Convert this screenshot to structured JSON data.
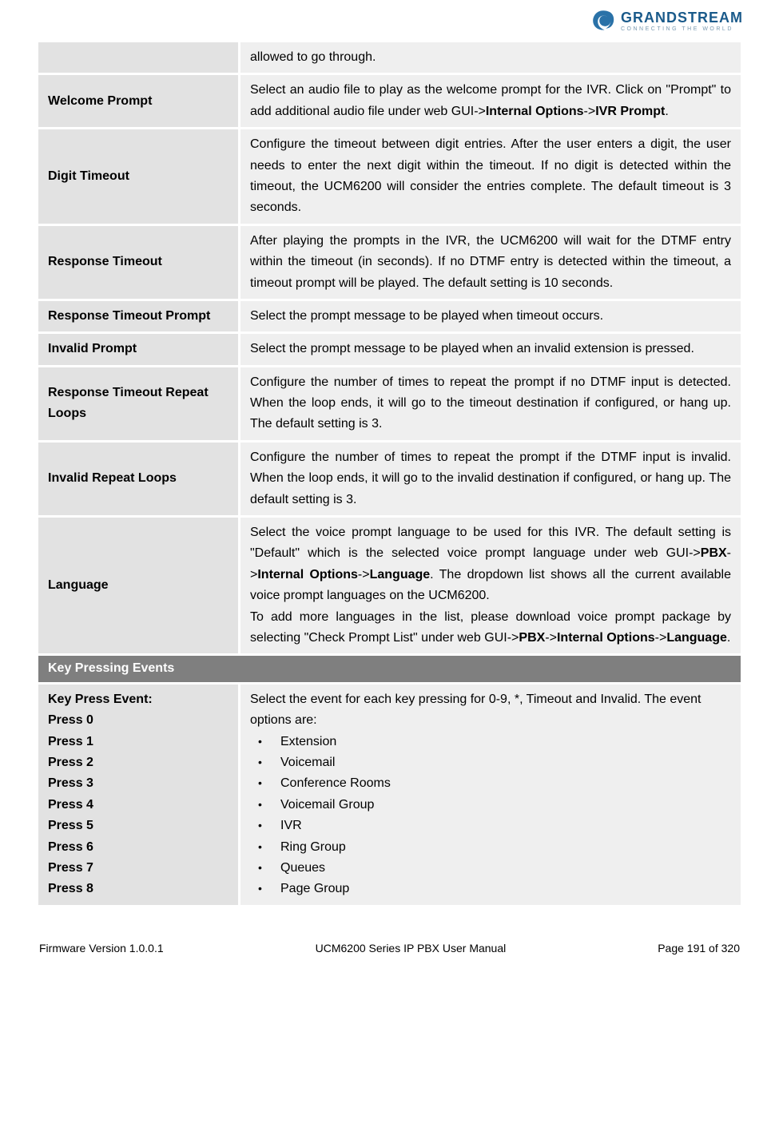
{
  "header": {
    "brand": "GRANDSTREAM",
    "tagline": "CONNECTING THE WORLD"
  },
  "rows": {
    "row0": {
      "desc": "allowed to go through."
    },
    "row1": {
      "label": "Welcome Prompt",
      "desc_pre": "Select an audio file to play as the welcome prompt for the IVR. Click on \"Prompt\" to add additional audio file under web GUI->",
      "b1": "Internal Options",
      "sep": "->",
      "b2": "IVR Prompt",
      "desc_post": "."
    },
    "row2": {
      "label": "Digit Timeout",
      "desc": "Configure the timeout between digit entries. After the user enters a digit, the user needs to enter the next digit within the timeout. If no digit is detected within the timeout, the UCM6200 will consider the entries complete. The default timeout is 3 seconds."
    },
    "row3": {
      "label": "Response Timeout",
      "desc": "After playing the prompts in the IVR, the UCM6200 will wait for the DTMF entry within the timeout (in seconds). If no DTMF entry is detected within the timeout, a timeout prompt will be played. The default setting is 10 seconds."
    },
    "row4": {
      "label": "Response Timeout Prompt",
      "desc": "Select the prompt message to be played when timeout occurs."
    },
    "row5": {
      "label": "Invalid Prompt",
      "desc": "Select the prompt message to be played when an invalid extension is pressed."
    },
    "row6": {
      "label": "Response Timeout Repeat Loops",
      "desc": "Configure the number of times to repeat the prompt if no DTMF input is detected. When the loop ends, it will go to the timeout destination if configured, or hang up. The default setting is 3."
    },
    "row7": {
      "label": "Invalid Repeat Loops",
      "desc": "Configure the number of times to repeat the prompt if the DTMF input is invalid. When the loop ends, it will go to the invalid destination if configured, or hang up. The default setting is 3."
    },
    "row8": {
      "label": "Language",
      "p1a": "Select the voice prompt language to be used for this IVR. The default setting is \"Default\" which is the selected voice prompt language under web GUI->",
      "p1b1": "PBX",
      "p1s1": "->",
      "p1b2": "Internal Options",
      "p1s2": "->",
      "p1b3": "Language",
      "p1c": ". The dropdown list shows all the current available voice prompt languages on the UCM6200.",
      "p2a": "To add more languages in the list, please download voice prompt package by selecting \"Check Prompt List\" under web GUI->",
      "p2b1": "PBX",
      "p2s1": "->",
      "p2b2": "Internal Options",
      "p2s2": "->",
      "p2b3": "Language",
      "p2c": "."
    }
  },
  "section": {
    "title": "Key Pressing Events"
  },
  "keypress": {
    "heading": "Key Press Event:",
    "items": [
      "Press 0",
      "Press 1",
      "Press 2",
      "Press 3",
      "Press 4",
      "Press 5",
      "Press 6",
      "Press 7",
      "Press 8"
    ],
    "desc_intro": "Select the event for each key pressing for 0-9, *, Timeout and Invalid. The event options are:",
    "options": [
      "Extension",
      "Voicemail",
      "Conference Rooms",
      "Voicemail Group",
      "IVR",
      "Ring Group",
      "Queues",
      "Page Group"
    ]
  },
  "footer": {
    "left": "Firmware Version 1.0.0.1",
    "center": "UCM6200 Series IP PBX User Manual",
    "right": "Page 191 of 320"
  }
}
